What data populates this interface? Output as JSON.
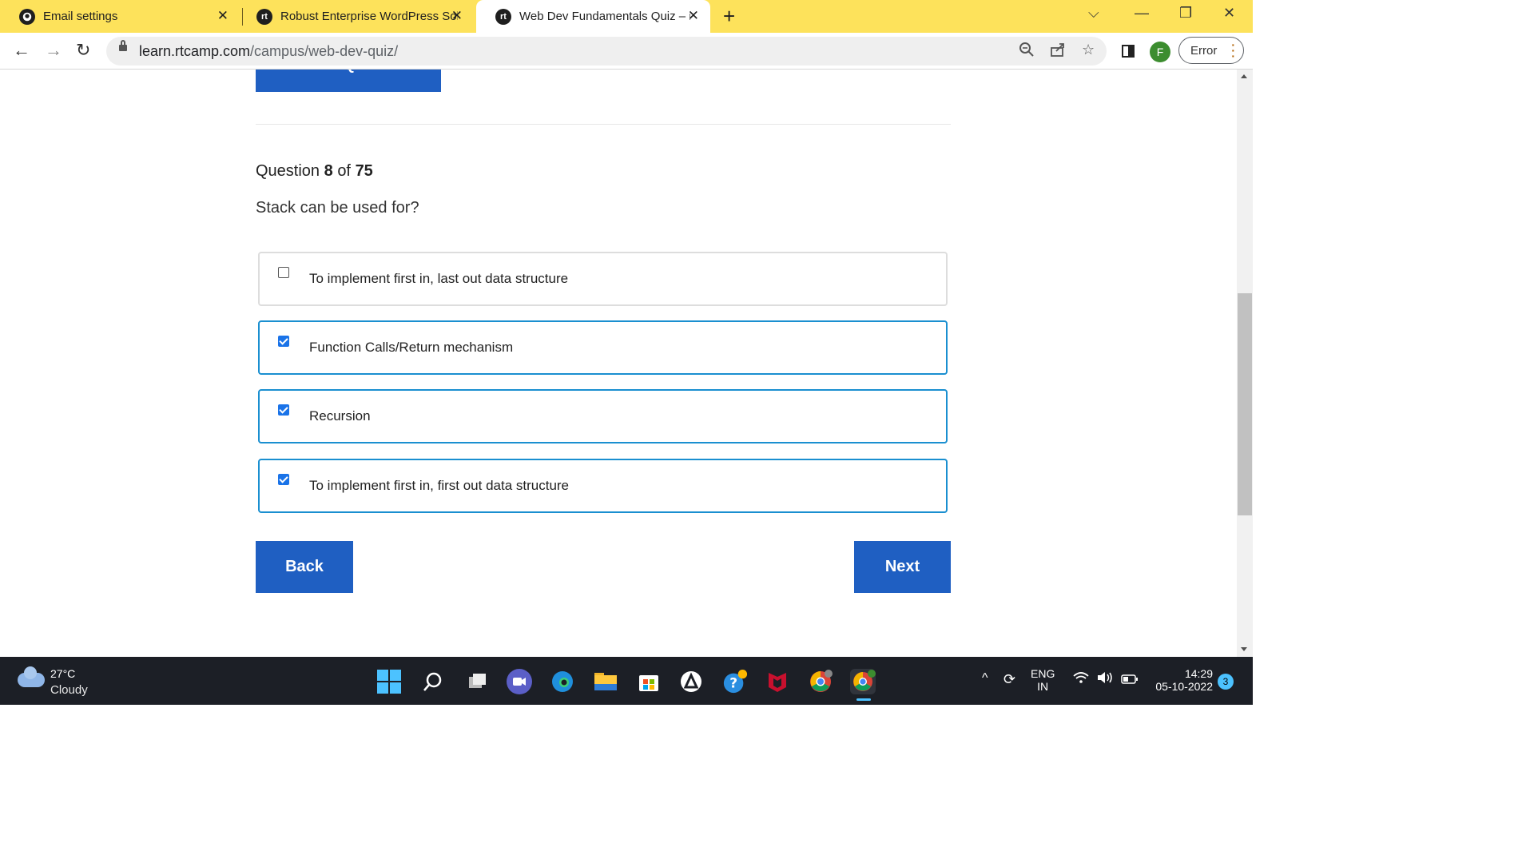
{
  "browser": {
    "tabs": [
      {
        "title": "Email settings",
        "icon": "github-icon"
      },
      {
        "title": "Robust Enterprise WordPress Sol",
        "icon": "rtcamp-icon"
      },
      {
        "title": "Web Dev Fundamentals Quiz – rt",
        "icon": "rtcamp-icon",
        "active": true
      }
    ],
    "new_tab_label": "+",
    "url_host": "learn.rtcamp.com",
    "url_path": "/campus/web-dev-quiz/",
    "profile_initial": "F",
    "error_label": "Error",
    "accent_color": "#fde25b"
  },
  "quiz": {
    "review_button_label": "Review Question",
    "question_prefix": "Question",
    "question_current": "8",
    "question_of": "of",
    "question_total": "75",
    "question_text": "Stack can be used for?",
    "options": [
      {
        "label": "To implement first in, last out data structure",
        "checked": false
      },
      {
        "label": "Function Calls/Return mechanism",
        "checked": true
      },
      {
        "label": "Recursion",
        "checked": true
      },
      {
        "label": "To implement first in, first out data structure",
        "checked": true
      }
    ],
    "back_label": "Back",
    "next_label": "Next",
    "button_color": "#1f5fc2",
    "checked_border_color": "#1a8fd0"
  },
  "taskbar": {
    "weather_temp": "27°C",
    "weather_desc": "Cloudy",
    "lang_top": "ENG",
    "lang_bottom": "IN",
    "time": "14:29",
    "date": "05-10-2022",
    "notification_count": "3"
  }
}
